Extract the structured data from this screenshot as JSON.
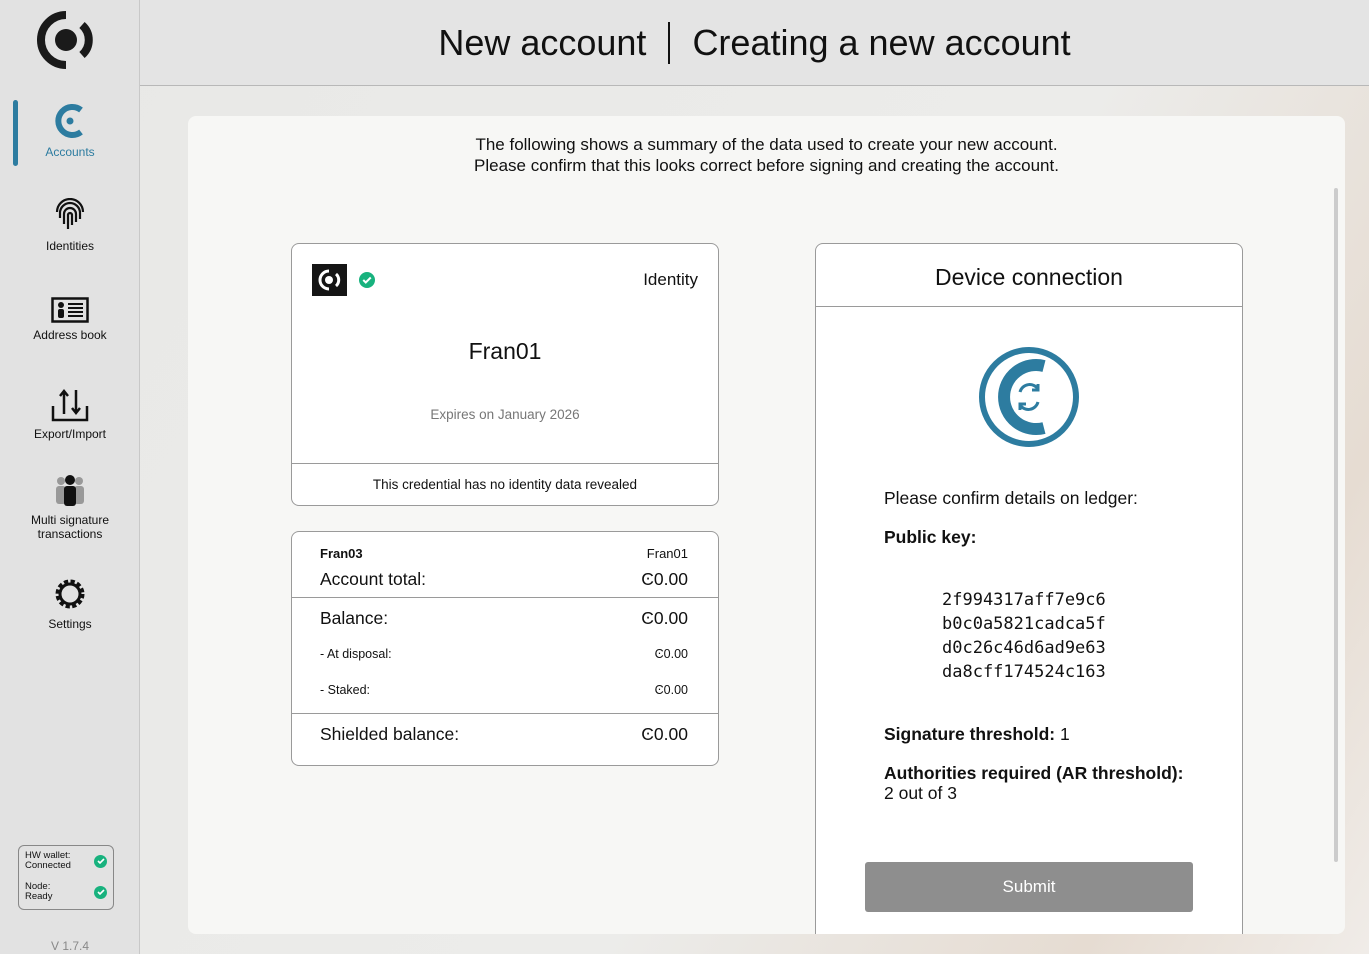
{
  "sidebar": {
    "items": [
      {
        "label": "Accounts",
        "icon": "accounts-icon",
        "active": true
      },
      {
        "label": "Identities",
        "icon": "fingerprint-icon"
      },
      {
        "label": "Address book",
        "icon": "address-book-icon"
      },
      {
        "label": "Export/Import",
        "icon": "export-import-icon"
      },
      {
        "label": "Multi signature transactions",
        "icon": "multisig-icon"
      },
      {
        "label": "Settings",
        "icon": "gear-icon"
      }
    ],
    "status": {
      "hw_label": "HW wallet:",
      "hw_value": "Connected",
      "node_label": "Node:",
      "node_value": "Ready"
    },
    "version": "V 1.7.4"
  },
  "header": {
    "title": "New account",
    "subtitle": "Creating a new account"
  },
  "intro": {
    "line1": "The following shows a summary of the data used to create your new account.",
    "line2": "Please confirm that this looks correct before signing and creating the account."
  },
  "identity": {
    "type": "Identity",
    "name": "Fran01",
    "expires": "Expires on January 2026",
    "note": "This credential has no identity data revealed"
  },
  "account": {
    "name": "Fran03",
    "identity": "Fran01",
    "total_label": "Account total:",
    "total": "Ͼ0.00",
    "balance_label": "Balance:",
    "balance": "Ͼ0.00",
    "disposal_label": "- At disposal:",
    "disposal": "Ͼ0.00",
    "staked_label": "- Staked:",
    "staked": "Ͼ0.00",
    "shielded_label": "Shielded balance:",
    "shielded": "Ͼ0.00"
  },
  "device": {
    "title": "Device connection",
    "confirm": "Please confirm details on ledger:",
    "pubkey_label": "Public key:",
    "pubkey": [
      "2f994317aff7e9c6",
      "b0c0a5821cadca5f",
      "d0c26c46d6ad9e63",
      "da8cff174524c163"
    ],
    "sig_label": "Signature threshold:",
    "sig_value": "1",
    "ar_label": "Authorities required (AR threshold):",
    "ar_value": "2 out of 3",
    "submit": "Submit"
  },
  "colors": {
    "accent": "#2d7ca0",
    "success": "#18b27e",
    "submit_bg": "#8e8e8e"
  }
}
